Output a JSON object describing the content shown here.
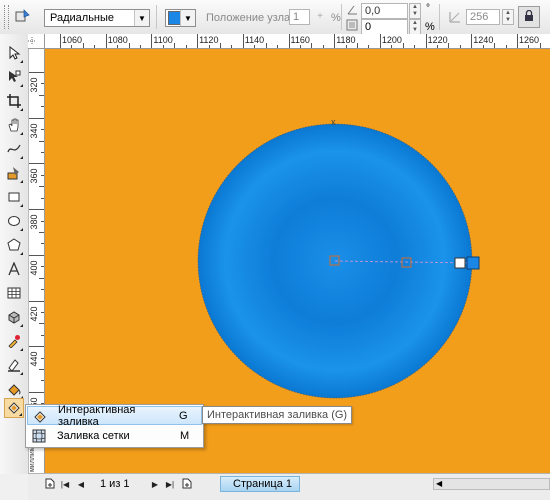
{
  "propertyBar": {
    "fillType": "Радиальные",
    "nodeColor": "#1a87e6",
    "nodePositionLabel": "Положение узла:",
    "nodePositionValue": "1",
    "nodePositionPercent": "%",
    "angleValue": "0,0",
    "angleUnit": "°",
    "edgePadValue": "0",
    "edgePadUnit": "%",
    "stepsValue": "256"
  },
  "rulers": {
    "horizontal": [
      "1060",
      "1080",
      "1100",
      "1120",
      "1140",
      "1160",
      "1180",
      "1200",
      "1220",
      "1240",
      "1260"
    ],
    "vertical": [
      "320",
      "340",
      "360",
      "380",
      "400",
      "420",
      "440",
      "460"
    ],
    "verticalUnitLabel": "миллиметры"
  },
  "canvas": {
    "background": "#f29e1b",
    "circleColorCenter": "#1a8fe8",
    "circleColorEdge": "#0a78d2"
  },
  "toolbox": {
    "icons": [
      "pick-tool-icon",
      "shape-tool-icon",
      "crop-tool-icon",
      "pan-tool-icon",
      "freehand-tool-icon",
      "smart-fill-tool-icon",
      "rectangle-tool-icon",
      "ellipse-tool-icon",
      "polygon-tool-icon",
      "text-tool-icon",
      "table-tool-icon",
      "extrude-tool-icon",
      "eyedropper-tool-icon",
      "outline-tool-icon",
      "fill-tool-icon",
      "interactive-fill-tool-icon"
    ]
  },
  "flyout": {
    "items": [
      {
        "label": "Интерактивная заливка",
        "shortcut": "G"
      },
      {
        "label": "Заливка сетки",
        "shortcut": "M"
      }
    ],
    "tooltip": "Интерактивная заливка (G)"
  },
  "statusBar": {
    "pageCounter": "1 из 1",
    "pageTab": "Страница 1"
  }
}
